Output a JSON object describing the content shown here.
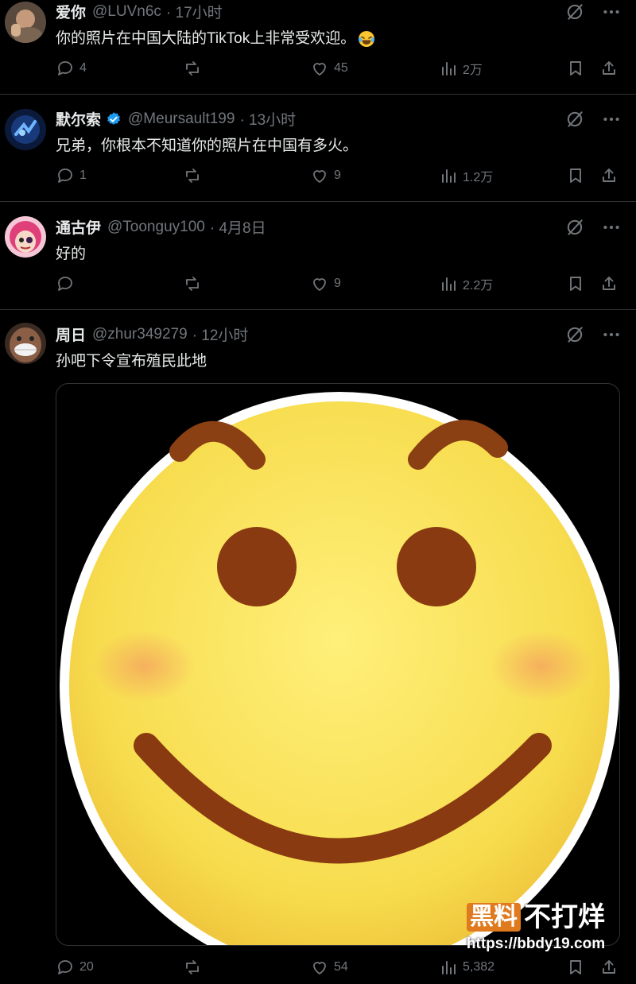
{
  "tweets": [
    {
      "name": "爱你",
      "handle": "@LUVn6c",
      "time": "· 17小时",
      "text": "你的照片在中国大陆的TikTok上非常受欢迎。",
      "emoji": "face-with-tears-of-joy",
      "verified": false,
      "stats": {
        "replies": "4",
        "reposts": "",
        "likes": "45",
        "views": "2万"
      }
    },
    {
      "name": "默尔索",
      "handle": "@Meursault199",
      "time": "· 13小时",
      "text": "兄弟，你根本不知道你的照片在中国有多火。",
      "verified": true,
      "stats": {
        "replies": "1",
        "reposts": "",
        "likes": "9",
        "views": "1.2万"
      }
    },
    {
      "name": "通古伊",
      "handle": "@Toonguy100",
      "time": "· 4月8日",
      "text": "好的",
      "verified": false,
      "stats": {
        "replies": "",
        "reposts": "",
        "likes": "9",
        "views": "2.2万"
      }
    },
    {
      "name": "周日",
      "handle": "@zhur349279",
      "time": "· 12小时",
      "text": "孙吧下令宣布殖民此地",
      "verified": false,
      "media": "smiling-face-sticker",
      "stats": {
        "replies": "20",
        "reposts": "",
        "likes": "54",
        "views": "5,382"
      }
    }
  ],
  "watermark": {
    "badge": "黑料",
    "rest": "不打烊",
    "url": "https://bbdy19.com"
  },
  "colors": {
    "background": "#000000",
    "text": "#e7e9ea",
    "muted": "#71767b",
    "verified": "#1d9bf0",
    "divider": "#2f3336"
  }
}
